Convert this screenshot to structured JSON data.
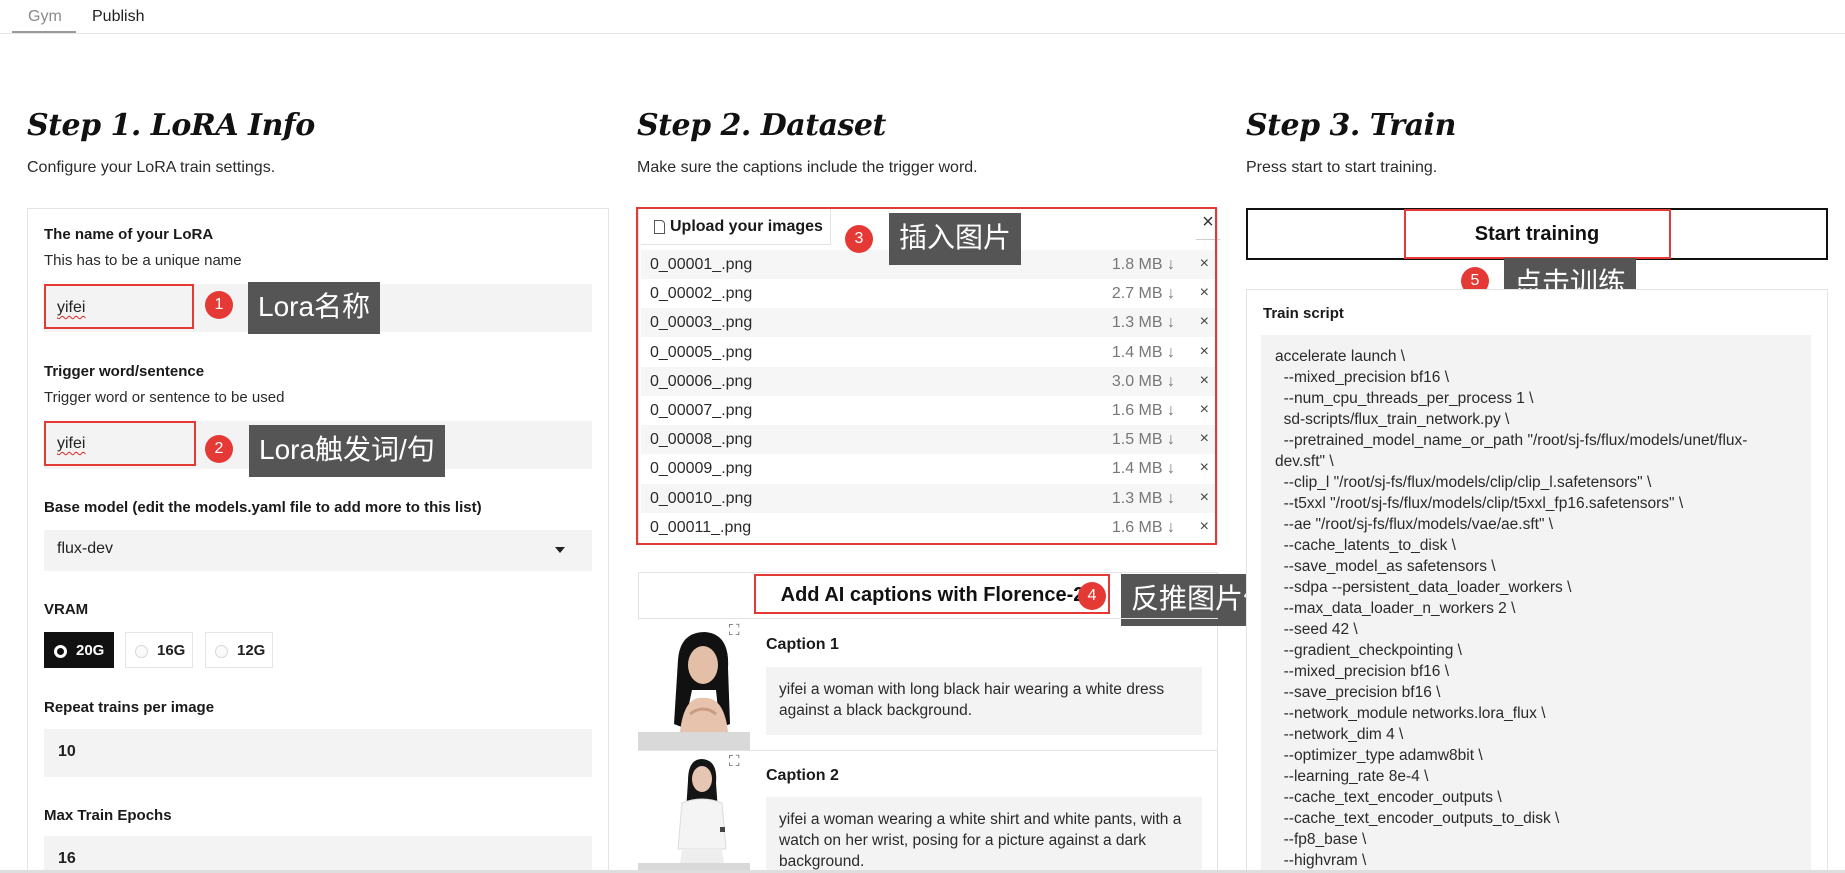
{
  "nav": {
    "tabs": [
      "Gym",
      "Publish"
    ],
    "active": "Gym"
  },
  "step1": {
    "title": "Step 1. LoRA Info",
    "subtitle": "Configure your LoRA train settings.",
    "lora_name": {
      "label": "The name of your LoRA",
      "hint": "This has to be a unique name",
      "value": "yifei"
    },
    "trigger": {
      "label": "Trigger word/sentence",
      "hint": "Trigger word or sentence to be used",
      "value": "yifei"
    },
    "base_model": {
      "label": "Base model (edit the models.yaml file to add more to this list)",
      "value": "flux-dev"
    },
    "vram": {
      "label": "VRAM",
      "options": [
        "20G",
        "16G",
        "12G"
      ],
      "selected": "20G"
    },
    "repeat": {
      "label": "Repeat trains per image",
      "value": "10"
    },
    "epochs": {
      "label": "Max Train Epochs",
      "value": "16"
    }
  },
  "step2": {
    "title": "Step 2. Dataset",
    "subtitle": "Make sure the captions include the trigger word.",
    "upload_label": "Upload your images",
    "close_glyph": "×",
    "files": [
      {
        "name": "0_00001_.png",
        "size": "1.8 MB ↓"
      },
      {
        "name": "0_00002_.png",
        "size": "2.7 MB ↓"
      },
      {
        "name": "0_00003_.png",
        "size": "1.3 MB ↓"
      },
      {
        "name": "0_00005_.png",
        "size": "1.4 MB ↓"
      },
      {
        "name": "0_00006_.png",
        "size": "3.0 MB ↓"
      },
      {
        "name": "0_00007_.png",
        "size": "1.6 MB ↓"
      },
      {
        "name": "0_00008_.png",
        "size": "1.5 MB ↓"
      },
      {
        "name": "0_00009_.png",
        "size": "1.4 MB ↓"
      },
      {
        "name": "0_00010_.png",
        "size": "1.3 MB ↓"
      },
      {
        "name": "0_00011_.png",
        "size": "1.6 MB ↓"
      }
    ],
    "remove_glyph": "×",
    "caption_button": "Add AI captions with Florence-2",
    "captions": [
      {
        "title": "Caption 1",
        "text": "yifei a woman with long black hair wearing a white dress against a black background."
      },
      {
        "title": "Caption 2",
        "text": "yifei a woman wearing a white shirt and white pants, with a watch on her wrist, posing for a picture against a dark background."
      }
    ]
  },
  "step3": {
    "title": "Step 3. Train",
    "subtitle": "Press start to start training.",
    "start_button": "Start training",
    "script_label": "Train script",
    "script": "accelerate launch \\\n  --mixed_precision bf16 \\\n  --num_cpu_threads_per_process 1 \\\n  sd-scripts/flux_train_network.py \\\n  --pretrained_model_name_or_path \"/root/sj-fs/flux/models/unet/flux-dev.sft\" \\\n  --clip_l \"/root/sj-fs/flux/models/clip/clip_l.safetensors\" \\\n  --t5xxl \"/root/sj-fs/flux/models/clip/t5xxl_fp16.safetensors\" \\\n  --ae \"/root/sj-fs/flux/models/vae/ae.sft\" \\\n  --cache_latents_to_disk \\\n  --save_model_as safetensors \\\n  --sdpa --persistent_data_loader_workers \\\n  --max_data_loader_n_workers 2 \\\n  --seed 42 \\\n  --gradient_checkpointing \\\n  --mixed_precision bf16 \\\n  --save_precision bf16 \\\n  --network_module networks.lora_flux \\\n  --network_dim 4 \\\n  --optimizer_type adamw8bit \\\n  --learning_rate 8e-4 \\\n  --cache_text_encoder_outputs \\\n  --cache_text_encoder_outputs_to_disk \\\n  --fp8_base \\\n  --highvram \\"
  },
  "annotations": [
    {
      "num": "1",
      "text": "Lora名称"
    },
    {
      "num": "2",
      "text": "Lora触发词/句"
    },
    {
      "num": "3",
      "text": "插入图片"
    },
    {
      "num": "4",
      "text": "反推图片信息"
    },
    {
      "num": "5",
      "text": "点击训练"
    }
  ],
  "colors": {
    "accent_red": "#e53935",
    "tooltip_bg": "#555555",
    "selected_radio": "#111111",
    "field_bg": "#f3f3f3"
  }
}
